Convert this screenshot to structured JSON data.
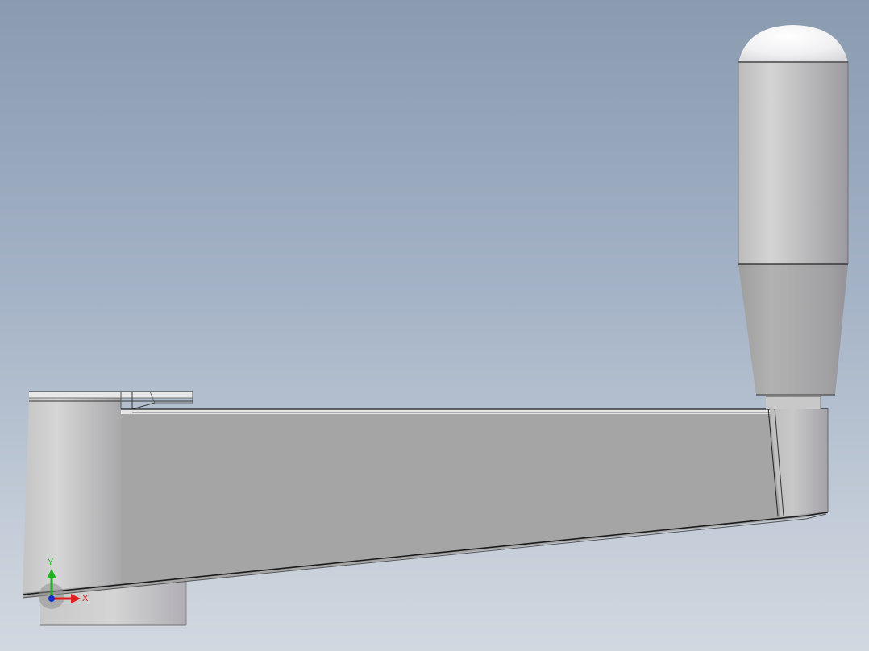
{
  "viewport": {
    "background_top": "#8a9bb0",
    "background_bottom": "#d2d8e0",
    "model": "crank-handle-3d-model"
  },
  "triad": {
    "x_label": "X",
    "y_label": "Y",
    "x_color": "#e02020",
    "y_color": "#20b020",
    "z_color": "#1030d0"
  }
}
